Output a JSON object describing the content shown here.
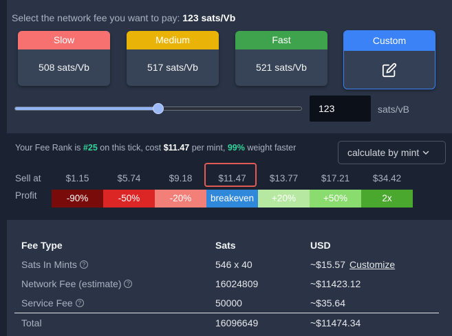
{
  "fee_prompt": {
    "text": "Select the network fee you want to pay:",
    "value": "123 sats/Vb"
  },
  "fee_options": [
    {
      "label": "Slow",
      "value": "508 sats/Vb",
      "color": "#f87171"
    },
    {
      "label": "Medium",
      "value": "517 sats/Vb",
      "color": "#eab308"
    },
    {
      "label": "Fast",
      "value": "521 sats/Vb",
      "color": "#3fa34d"
    }
  ],
  "custom_option": {
    "label": "Custom",
    "icon": "edit-icon",
    "color": "#3b82f6"
  },
  "slider": {
    "fraction": 0.5
  },
  "rate_input": {
    "value": "123",
    "unit": "sats/vB"
  },
  "rank": {
    "prefix": "Your Fee Rank is",
    "rank": "#25",
    "middle": "on this tick, cost",
    "cost": "$11.47",
    "per": "per mint,",
    "pct": "99%",
    "suffix": "weight faster"
  },
  "calc_select": {
    "value": "calculate by mint",
    "icon": "chevron-down-icon"
  },
  "sell_label": "Sell at",
  "profit_label": "Profit",
  "sell_prices": [
    "$1.15",
    "$5.74",
    "$9.18",
    "$11.47",
    "$13.77",
    "$17.21",
    "$34.42"
  ],
  "highlighted_index": 3,
  "profit": [
    {
      "label": "-90%",
      "color": "#7a0b0b"
    },
    {
      "label": "-50%",
      "color": "#dc2626"
    },
    {
      "label": "-20%",
      "color": "#f28079"
    },
    {
      "label": "breakeven",
      "color": "#2f88d9"
    },
    {
      "label": "+20%",
      "color": "#b6e8a1"
    },
    {
      "label": "+50%",
      "color": "#8bdc6f"
    },
    {
      "label": "2x",
      "color": "#4aa82f"
    }
  ],
  "table": {
    "headers": [
      "Fee Type",
      "Sats",
      "USD"
    ],
    "rows": [
      {
        "label": "Sats In Mints",
        "sats": "546 x 40",
        "usd": "~$15.57",
        "link": "Customize"
      },
      {
        "label": "Network Fee (estimate)",
        "sats": "16024809",
        "usd": "~$11423.12"
      },
      {
        "label": "Service Fee",
        "sats": "50000",
        "usd": "~$35.64"
      }
    ],
    "total": {
      "label": "Total",
      "sats": "16096649",
      "usd": "~$11474.34"
    }
  }
}
